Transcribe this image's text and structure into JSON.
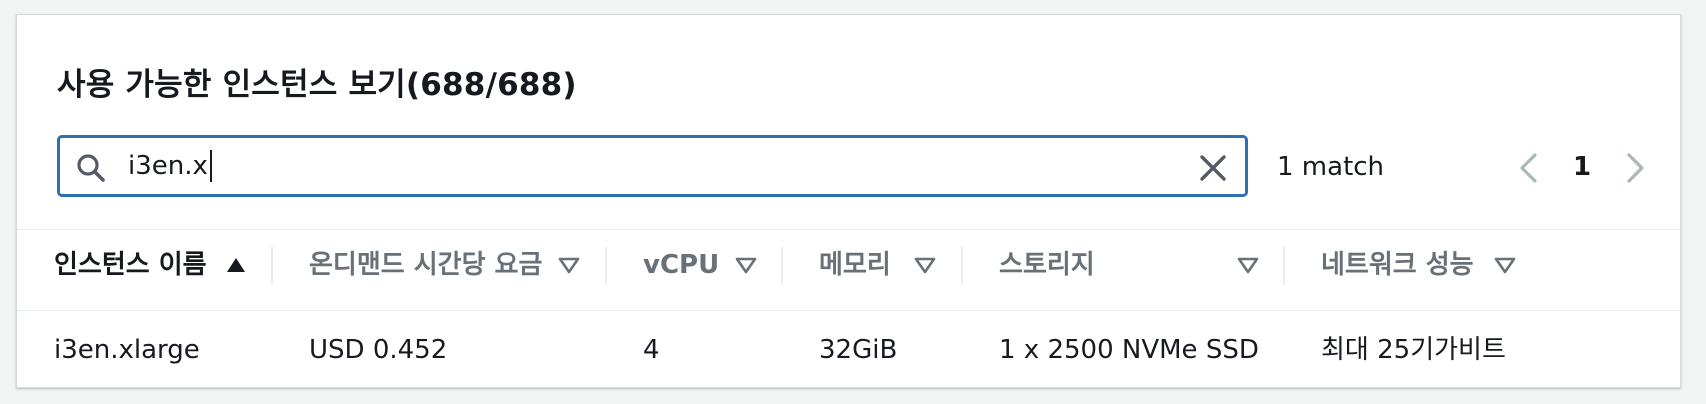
{
  "title": "사용 가능한 인스턴스 보기(688/688)",
  "search": {
    "value": "i3en.x",
    "placeholder": ""
  },
  "match_text": "1 match",
  "pagination": {
    "current_page": "1"
  },
  "columns": [
    {
      "label": "인스턴스 이름",
      "sort": "ascending"
    },
    {
      "label": "온디맨드 시간당 요금",
      "sort": "none"
    },
    {
      "label": "vCPU",
      "sort": "none"
    },
    {
      "label": "메모리",
      "sort": "none"
    },
    {
      "label": "스토리지",
      "sort": "none"
    },
    {
      "label": "네트워크 성능",
      "sort": "none"
    }
  ],
  "rows": [
    [
      "i3en.xlarge",
      "USD 0.452",
      "4",
      "32GiB",
      "1 x 2500 NVMe SSD",
      "최대 25기가비트"
    ]
  ],
  "colors": {
    "focus_border": "#2e6fb3",
    "text": "#16191f",
    "muted": "#687078",
    "disabled": "#aab7b8"
  }
}
